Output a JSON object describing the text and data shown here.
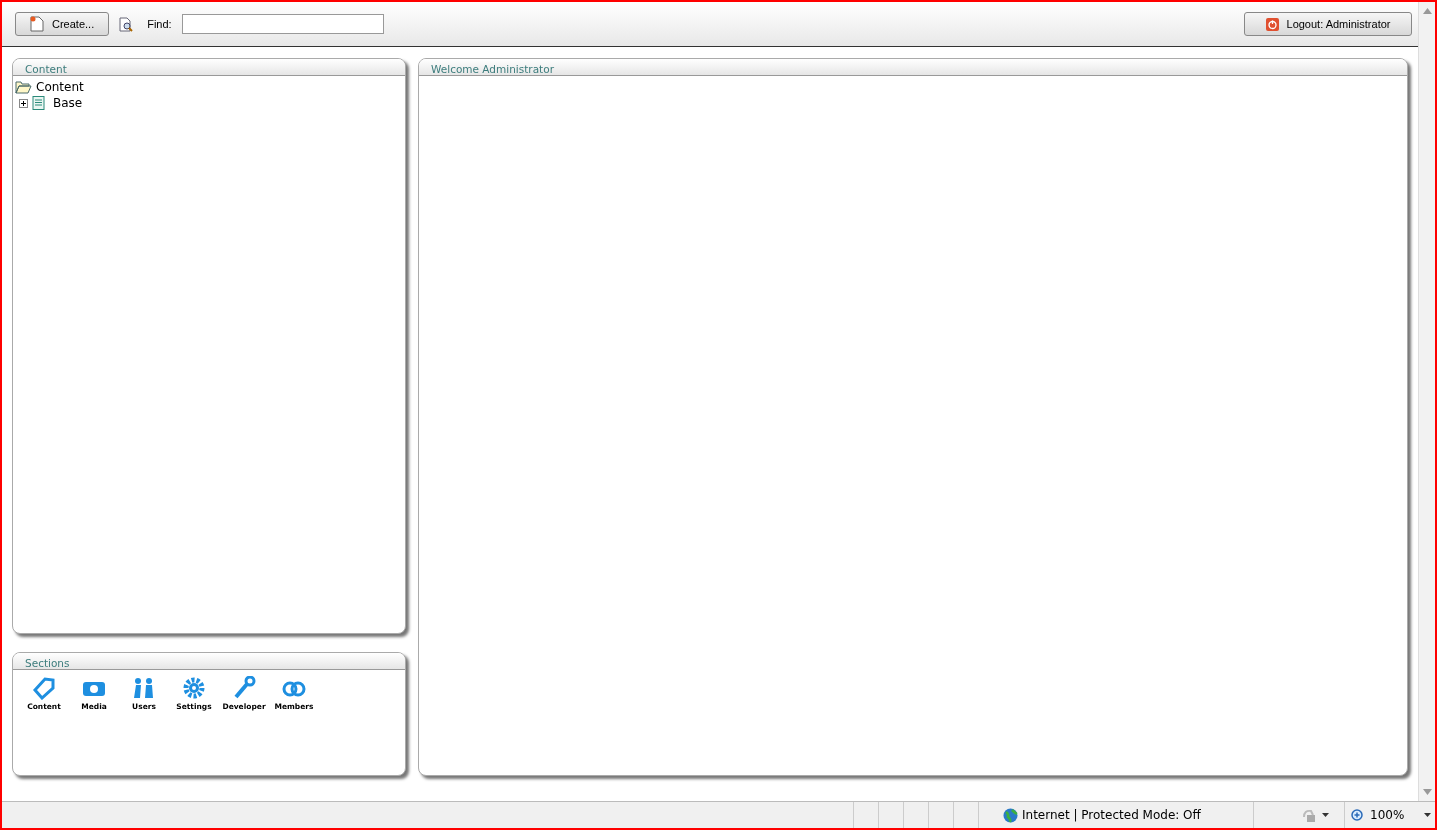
{
  "toolbar": {
    "create_button": "Create...",
    "find_label": "Find:",
    "logout_button": "Logout: Administrator"
  },
  "tree_panel": {
    "title": "Content",
    "tree": [
      {
        "label": "Content",
        "kind": "folder",
        "expanded": true,
        "children": [
          {
            "label": "Base",
            "kind": "document",
            "expanded": false
          }
        ]
      }
    ]
  },
  "sections_panel": {
    "title": "Sections",
    "items": [
      {
        "label": "Content",
        "kind": "content"
      },
      {
        "label": "Media",
        "kind": "media"
      },
      {
        "label": "Users",
        "kind": "users"
      },
      {
        "label": "Settings",
        "kind": "settings"
      },
      {
        "label": "Developer",
        "kind": "developer"
      },
      {
        "label": "Members",
        "kind": "members"
      }
    ]
  },
  "main_panel": {
    "title": "Welcome Administrator"
  },
  "status_bar": {
    "zone": "Internet | Protected Mode: Off",
    "zoom": "100%"
  }
}
